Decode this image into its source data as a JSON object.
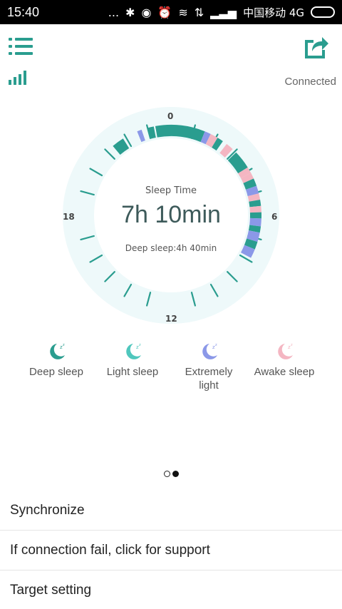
{
  "status_bar": {
    "time": "15:40",
    "dots": "...",
    "carrier": "中国移动 4G"
  },
  "header": {
    "connection_status": "Connected"
  },
  "dial": {
    "label": "Sleep Time",
    "total": "7h 10min",
    "deep_summary": "Deep sleep:4h 40min",
    "hour_labels": [
      "0",
      "6",
      "12",
      "18"
    ]
  },
  "legend": [
    {
      "label": "Deep sleep",
      "color": "#2a9d8f"
    },
    {
      "label": "Light sleep",
      "color": "#4fc7bd"
    },
    {
      "label": "Extremely light",
      "color": "#8b98e8"
    },
    {
      "label": "Awake sleep",
      "color": "#f4b6c2"
    }
  ],
  "pager": {
    "count": 2,
    "active": 1
  },
  "menu": [
    {
      "label": "Synchronize"
    },
    {
      "label": "If connection fail, click for support"
    },
    {
      "label": "Target setting"
    }
  ],
  "colors": {
    "accent": "#2a9d8f",
    "ring_bg": "#eef9fa"
  }
}
